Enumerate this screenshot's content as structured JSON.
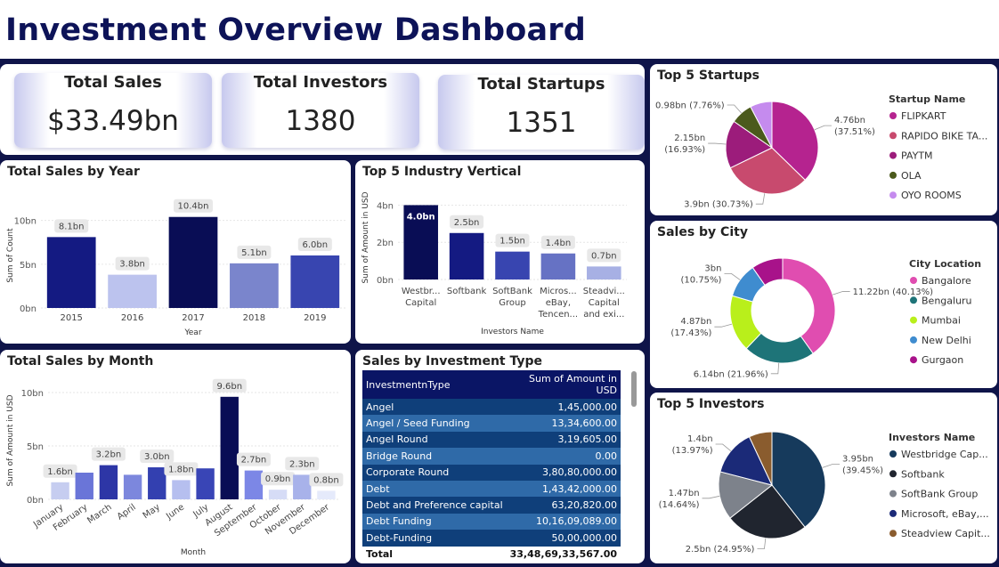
{
  "page": {
    "title": "Investment Overview Dashboard"
  },
  "kpis": [
    {
      "label": "Total Sales",
      "value": "$33.49bn"
    },
    {
      "label": "Total Investors",
      "value": "1380"
    },
    {
      "label": "Total Startups",
      "value": "1351"
    }
  ],
  "colors": {
    "background": "#0f1449",
    "title": "#0d1358"
  },
  "year_chart": {
    "title": "Total Sales by Year",
    "chart_data": {
      "type": "bar",
      "categories": [
        "2015",
        "2016",
        "2017",
        "2018",
        "2019"
      ],
      "values": [
        8.1,
        3.8,
        10.4,
        5.1,
        6.0
      ],
      "data_labels": [
        "8.1bn",
        "3.8bn",
        "10.4bn",
        "5.1bn",
        "6.0bn"
      ],
      "colors": [
        "#141a82",
        "#bcc3ee",
        "#090d55",
        "#7a85cc",
        "#3845b0"
      ],
      "xlabel": "Year",
      "ylabel": "Sum of Count",
      "yticks": [
        0,
        5,
        10
      ],
      "ytick_labels": [
        "0bn",
        "5bn",
        "10bn"
      ],
      "ylim": [
        0,
        12
      ]
    }
  },
  "industry_chart": {
    "title": "Top 5 Industry Vertical",
    "chart_data": {
      "type": "bar",
      "categories": [
        [
          "Westbr...",
          "Capital"
        ],
        [
          "Softbank"
        ],
        [
          "SoftBank",
          "Group"
        ],
        [
          "Micros...",
          "eBay,",
          "Tencen..."
        ],
        [
          "Steadvi...",
          "Capital",
          "and exi..."
        ]
      ],
      "values": [
        4.0,
        2.5,
        1.5,
        1.4,
        0.7
      ],
      "data_labels": [
        "4.0bn",
        "2.5bn",
        "1.5bn",
        "1.4bn",
        "0.7bn"
      ],
      "colors": [
        "#090d55",
        "#141a82",
        "#3845b0",
        "#6672c4",
        "#a7b0e4"
      ],
      "xlabel": "Investors Name",
      "ylabel": "Sum of Amount in USD",
      "yticks": [
        0,
        2,
        4
      ],
      "ytick_labels": [
        "0bn",
        "2bn",
        "4bn"
      ],
      "ylim": [
        0,
        4.5
      ]
    }
  },
  "month_chart": {
    "title": "Total Sales by Month",
    "chart_data": {
      "type": "bar",
      "categories": [
        "January",
        "February",
        "March",
        "April",
        "May",
        "June",
        "July",
        "August",
        "September",
        "October",
        "November",
        "December"
      ],
      "values": [
        1.6,
        2.5,
        3.2,
        2.3,
        3.0,
        1.8,
        2.9,
        9.6,
        2.7,
        0.9,
        2.3,
        0.8
      ],
      "data_labels": [
        "1.6bn",
        "",
        "3.2bn",
        "",
        "3.0bn",
        "1.8bn",
        "",
        "9.6bn",
        "2.7bn",
        "0.9bn",
        "2.3bn",
        "0.8bn"
      ],
      "colors": [
        "#c6cdf0",
        "#6a75d8",
        "#2d36a6",
        "#7c87dd",
        "#3340b0",
        "#b6bfef",
        "#3945b6",
        "#090d55",
        "#7c87e6",
        "#d6dcf6",
        "#a8b2ea",
        "#e5eafb"
      ],
      "xlabel": "Month",
      "ylabel": "Sum of Amount in USD",
      "yticks": [
        0,
        5,
        10
      ],
      "ytick_labels": [
        "0bn",
        "5bn",
        "10bn"
      ],
      "ylim": [
        0,
        11
      ]
    }
  },
  "investment_table": {
    "title": "Sales by Investment Type",
    "chart_data": {
      "type": "table",
      "headers": [
        "InvestmentnType",
        "Sum of Amount in USD"
      ],
      "rows": [
        [
          "Angel",
          "1,45,000.00"
        ],
        [
          "Angel / Seed Funding",
          "13,34,600.00"
        ],
        [
          "Angel Round",
          "3,19,605.00"
        ],
        [
          "Bridge Round",
          "0.00"
        ],
        [
          "Corporate Round",
          "3,80,80,000.00"
        ],
        [
          "Debt",
          "1,43,42,000.00"
        ],
        [
          "Debt and Preference capital",
          "63,20,820.00"
        ],
        [
          "Debt Funding",
          "10,16,09,089.00"
        ],
        [
          "Debt-Funding",
          "50,00,000.00"
        ]
      ],
      "total": [
        "Total",
        "33,48,69,33,567.00"
      ]
    }
  },
  "startups_chart": {
    "title": "Top 5 Startups",
    "legend_title": "Startup Name",
    "chart_data": {
      "type": "pie",
      "labels": [
        "FLIPKART",
        "RAPIDO BIKE TA...",
        "PAYTM",
        "OLA",
        "OYO ROOMS"
      ],
      "values": [
        4.76,
        3.9,
        2.15,
        0.98,
        0.98
      ],
      "colors": [
        "#b5238f",
        "#c84a6e",
        "#9c1c7b",
        "#4b5a1c",
        "#c58bee"
      ],
      "callouts": [
        [
          "4.76bn",
          "(37.51%)"
        ],
        [
          "3.9bn (30.73%)"
        ],
        [
          "2.15bn",
          "(16.93%)"
        ],
        [
          "0.98bn (7.76%)"
        ]
      ],
      "legend_position": "right"
    }
  },
  "city_chart": {
    "title": "Sales by City",
    "legend_title": "City  Location",
    "chart_data": {
      "type": "pie",
      "donut": true,
      "labels": [
        "Bangalore",
        "Bengaluru",
        "Mumbai",
        "New Delhi",
        "Gurgaon"
      ],
      "values": [
        11.22,
        6.14,
        4.87,
        3.0,
        2.7
      ],
      "colors": [
        "#e04db0",
        "#1e7478",
        "#b9ef1b",
        "#3f8ccf",
        "#a8128a"
      ],
      "callouts": [
        [
          "11.22bn (40.13%)"
        ],
        [
          "6.14bn (21.96%)"
        ],
        [
          "4.87bn",
          "(17.43%)"
        ],
        [
          "3bn",
          "(10.75%)"
        ]
      ],
      "legend_position": "right"
    }
  },
  "investors_chart": {
    "title": "Top 5 Investors",
    "legend_title": "Investors Name",
    "chart_data": {
      "type": "pie",
      "labels": [
        "Westbridge Cap...",
        "Softbank",
        "SoftBank Group",
        "Microsoft, eBay,...",
        "Steadview Capit..."
      ],
      "values": [
        3.95,
        2.5,
        1.47,
        1.4,
        0.7
      ],
      "colors": [
        "#163a5c",
        "#20252f",
        "#7d828b",
        "#1b2a78",
        "#8a5c2e"
      ],
      "callouts": [
        [
          "3.95bn",
          "(39.45%)"
        ],
        [
          "2.5bn (24.95%)"
        ],
        [
          "1.47bn",
          "(14.64%)"
        ],
        [
          "1.4bn",
          "(13.97%)"
        ]
      ],
      "legend_position": "right"
    }
  }
}
